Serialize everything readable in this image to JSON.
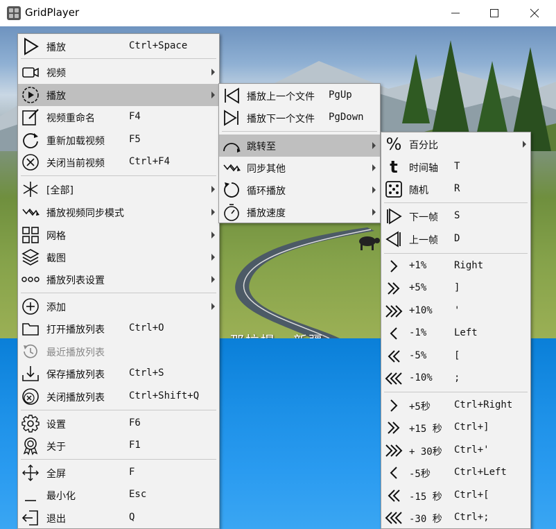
{
  "window": {
    "title": "GridPlayer"
  },
  "video": {
    "caption": "那拉提 · 新疆"
  },
  "main_menu": {
    "play": {
      "label": "播放",
      "shortcut": "Ctrl+Space"
    },
    "video": {
      "label": "视频"
    },
    "playback": {
      "label": "播放"
    },
    "rename": {
      "label": "视频重命名",
      "shortcut": "F4"
    },
    "reload": {
      "label": "重新加载视频",
      "shortcut": "F5"
    },
    "close_video": {
      "label": "关闭当前视频",
      "shortcut": "Ctrl+F4"
    },
    "all": {
      "label": "[全部]"
    },
    "sync_mode": {
      "label": "播放视频同步模式"
    },
    "grid": {
      "label": "网格"
    },
    "screenshot": {
      "label": "截图"
    },
    "playlist_settings": {
      "label": "播放列表设置"
    },
    "add": {
      "label": "添加"
    },
    "open_playlist": {
      "label": "打开播放列表",
      "shortcut": "Ctrl+O"
    },
    "recent_playlists": {
      "label": "最近播放列表"
    },
    "save_playlist": {
      "label": "保存播放列表",
      "shortcut": "Ctrl+S"
    },
    "close_playlist": {
      "label": "关闭播放列表",
      "shortcut": "Ctrl+Shift+Q"
    },
    "settings": {
      "label": "设置",
      "shortcut": "F6"
    },
    "about": {
      "label": "关于",
      "shortcut": "F1"
    },
    "fullscreen": {
      "label": "全屏",
      "shortcut": "F"
    },
    "minimize": {
      "label": "最小化",
      "shortcut": "Esc"
    },
    "exit": {
      "label": "退出",
      "shortcut": "Q"
    }
  },
  "playback_menu": {
    "prev_file": {
      "label": "播放上一个文件",
      "shortcut": "PgUp"
    },
    "next_file": {
      "label": "播放下一个文件",
      "shortcut": "PgDown"
    },
    "seek": {
      "label": "跳转至"
    },
    "sync_others": {
      "label": "同步其他"
    },
    "loop": {
      "label": "循环播放"
    },
    "speed": {
      "label": "播放速度"
    }
  },
  "seek_menu": {
    "percent": {
      "label": "百分比"
    },
    "timeline": {
      "label": "时间轴",
      "shortcut": "T"
    },
    "random": {
      "label": "随机",
      "shortcut": "R"
    },
    "next_frame": {
      "label": "下一帧",
      "shortcut": "S"
    },
    "prev_frame": {
      "label": "上一帧",
      "shortcut": "D"
    },
    "steps_percent": [
      {
        "label": "+1%",
        "shortcut": "Right"
      },
      {
        "label": "+5%",
        "shortcut": "]"
      },
      {
        "label": "+10%",
        "shortcut": "'"
      },
      {
        "label": "-1%",
        "shortcut": "Left"
      },
      {
        "label": "-5%",
        "shortcut": "["
      },
      {
        "label": "-10%",
        "shortcut": ";"
      }
    ],
    "steps_seconds": [
      {
        "label": "+5秒",
        "shortcut": "Ctrl+Right"
      },
      {
        "label": "+15 秒",
        "shortcut": "Ctrl+]"
      },
      {
        "label": "+ 30秒",
        "shortcut": "Ctrl+'"
      },
      {
        "label": "-5秒",
        "shortcut": "Ctrl+Left"
      },
      {
        "label": "-15 秒",
        "shortcut": "Ctrl+["
      },
      {
        "label": "-30 秒",
        "shortcut": "Ctrl+;"
      }
    ]
  }
}
